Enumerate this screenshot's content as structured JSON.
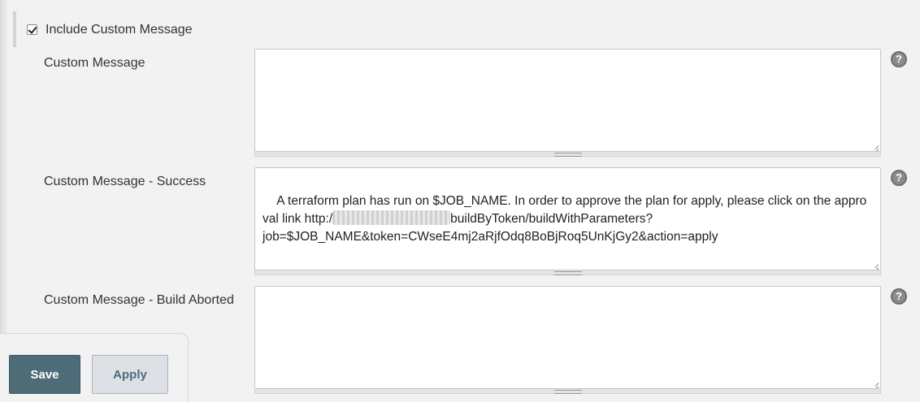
{
  "include_custom_message": {
    "label": "Include Custom Message",
    "checked": true
  },
  "fields": {
    "custom_message": {
      "label": "Custom Message",
      "value": ""
    },
    "custom_message_success": {
      "label": "Custom Message - Success",
      "value_part1": "A terraform plan has run on $JOB_NAME. In order to approve the plan for apply, please click on the approval link http:/",
      "value_part2": "buildByToken/buildWithParameters?\njob=$JOB_NAME&token=CWseE4mj2aRjfOdq8BoBjRoq5UnKjGy2&action=apply"
    },
    "custom_message_aborted": {
      "label": "Custom Message - Build Aborted",
      "value": ""
    }
  },
  "help_icon_glyph": "?",
  "buttons": {
    "save": "Save",
    "apply": "Apply"
  },
  "colors": {
    "save_button": "#4d6c78",
    "apply_button": "#dde1e6",
    "background": "#f2f2f2"
  }
}
